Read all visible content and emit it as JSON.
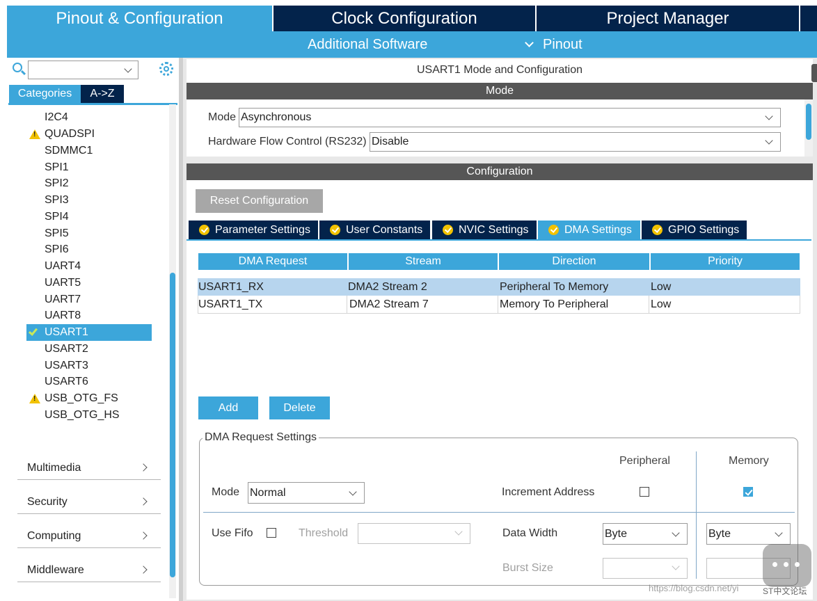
{
  "top_tabs": [
    "Pinout & Configuration",
    "Clock Configuration",
    "Project Manager"
  ],
  "subbar": {
    "additional_software": "Additional Software",
    "pinout": "Pinout"
  },
  "left": {
    "search_value": "",
    "tabs": [
      "Categories",
      "A->Z"
    ],
    "tree_items": [
      "I2C4",
      "QUADSPI",
      "SDMMC1",
      "SPI1",
      "SPI2",
      "SPI3",
      "SPI4",
      "SPI5",
      "SPI6",
      "UART4",
      "UART5",
      "UART7",
      "UART8",
      "USART1",
      "USART2",
      "USART3",
      "USART6",
      "USB_OTG_FS",
      "USB_OTG_HS"
    ],
    "groups": [
      "Multimedia",
      "Security",
      "Computing",
      "Middleware"
    ]
  },
  "panel": {
    "title": "USART1 Mode and Configuration",
    "mode_header": "Mode",
    "mode_label": "Mode",
    "mode_value": "Asynchronous",
    "hwfc_label": "Hardware Flow Control (RS232)",
    "hwfc_value": "Disable",
    "config_header": "Configuration",
    "reset_button": "Reset Configuration",
    "tabs": [
      "Parameter Settings",
      "User Constants",
      "NVIC Settings",
      "DMA Settings",
      "GPIO Settings"
    ],
    "table": {
      "headers": [
        "DMA Request",
        "Stream",
        "Direction",
        "Priority"
      ],
      "rows": [
        [
          "USART1_RX",
          "DMA2 Stream 2",
          "Peripheral To Memory",
          "Low"
        ],
        [
          "USART1_TX",
          "DMA2 Stream 7",
          "Memory To Peripheral",
          "Low"
        ]
      ]
    },
    "add_button": "Add",
    "delete_button": "Delete",
    "dma_settings": {
      "legend": "DMA Request Settings",
      "peripheral_col": "Peripheral",
      "memory_col": "Memory",
      "mode_label": "Mode",
      "mode_value": "Normal",
      "increment_label": "Increment Address",
      "use_fifo_label": "Use Fifo",
      "threshold_label": "Threshold",
      "threshold_value": "",
      "data_width_label": "Data Width",
      "peripheral_width": "Byte",
      "memory_width": "Byte",
      "burst_label": "Burst Size"
    }
  },
  "watermark": {
    "url": "https://blog.csdn.net/yi",
    "forum": "ST中文论坛"
  },
  "colors": {
    "accent": "#3ca6da",
    "navy": "#03234b",
    "bar": "#565656",
    "warning": "#f2c200"
  }
}
